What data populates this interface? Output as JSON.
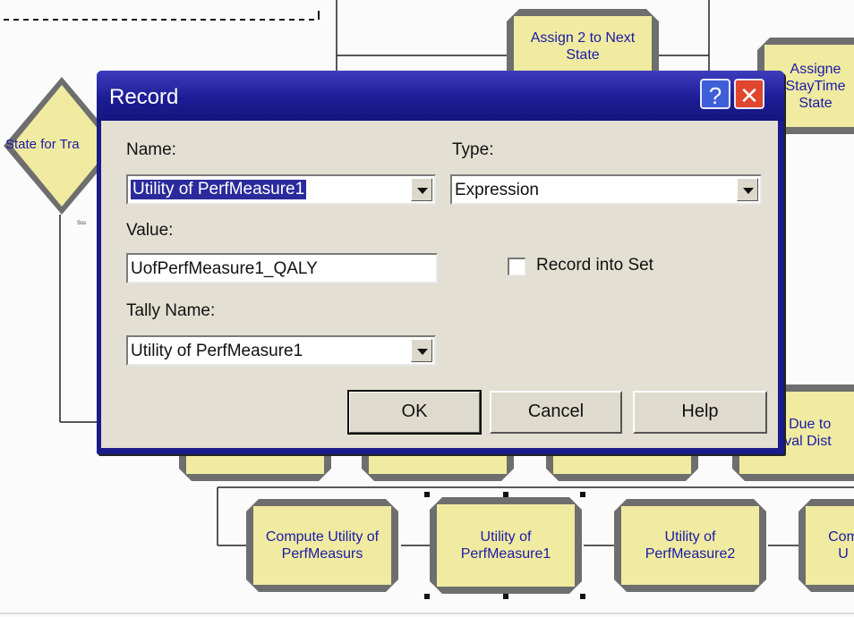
{
  "flowchart": {
    "decision_label": "State for Tra",
    "small_label": "Sss",
    "blocks": [
      {
        "label": "Assign 2 to Next\nState"
      },
      {
        "label": "Assigne\nStayTime\nState"
      },
      {
        "label": "e Due to\nrival Dist"
      },
      {
        "label": "Compute Utility of\nPerfMeasurs"
      },
      {
        "label": "Utility of\nPerfMeasure1"
      },
      {
        "label": "Utility of\nPerfMeasure2"
      },
      {
        "label": "Com\nU"
      }
    ]
  },
  "dialog": {
    "title": "Record",
    "help_glyph": "?",
    "close_glyph": "✕",
    "name_label": "Name:",
    "name_value": "Utility of PerfMeasure1",
    "type_label": "Type:",
    "type_value": "Expression",
    "value_label": "Value:",
    "value_value": "UofPerfMeasure1_QALY",
    "record_into_set_label": "Record into Set",
    "record_into_set_checked": false,
    "tally_label": "Tally Name:",
    "tally_value": "Utility of PerfMeasure1",
    "ok_label": "OK",
    "cancel_label": "Cancel",
    "help_label": "Help"
  }
}
